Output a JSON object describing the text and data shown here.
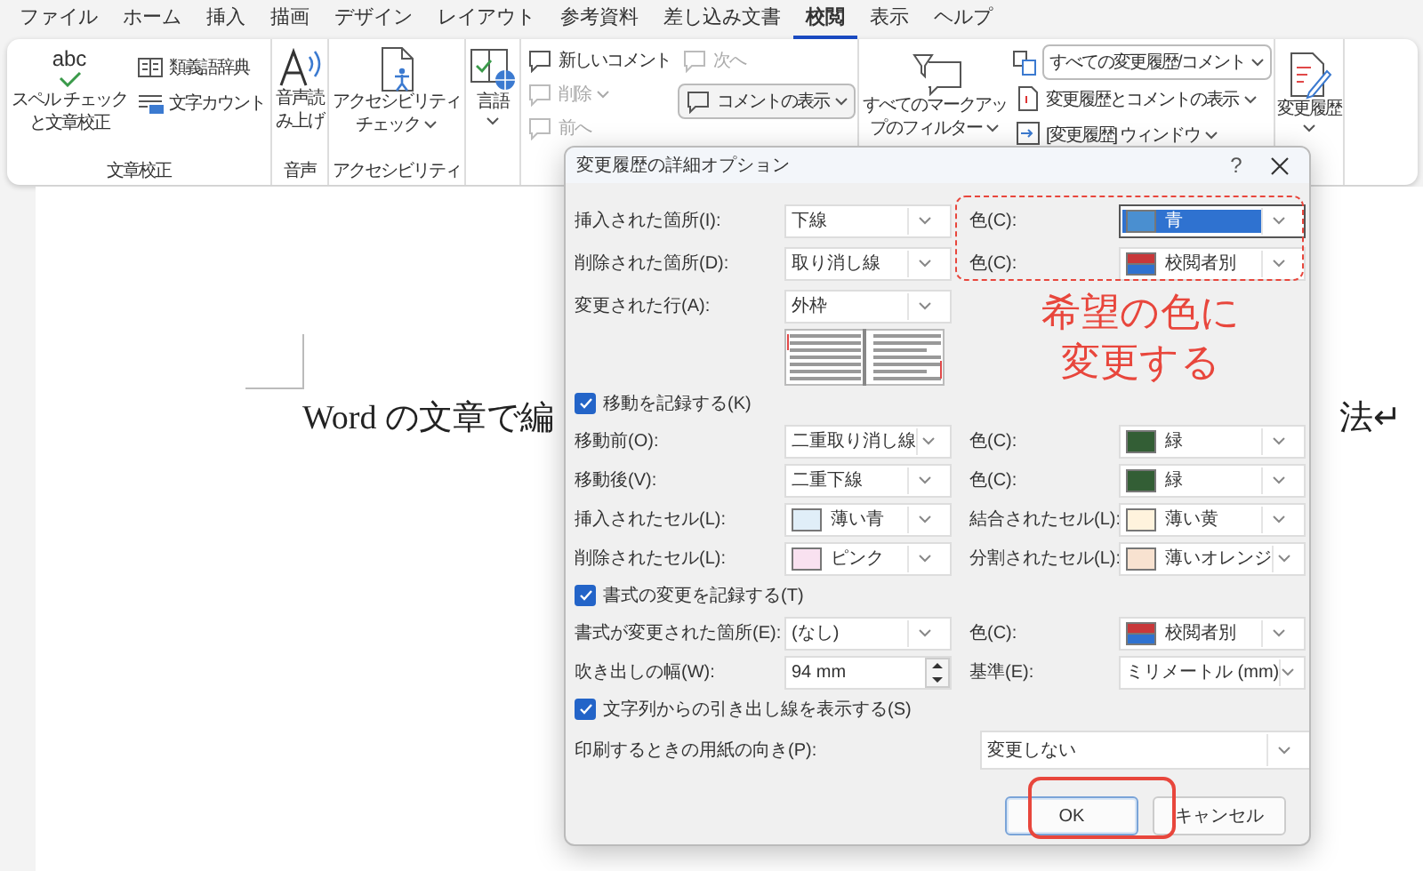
{
  "menu": [
    {
      "label": "ファイル",
      "selected": false
    },
    {
      "label": "ホーム",
      "selected": false
    },
    {
      "label": "挿入",
      "selected": false
    },
    {
      "label": "描画",
      "selected": false
    },
    {
      "label": "デザイン",
      "selected": false
    },
    {
      "label": "レイアウト",
      "selected": false
    },
    {
      "label": "参考資料",
      "selected": false
    },
    {
      "label": "差し込み文書",
      "selected": false
    },
    {
      "label": "校閲",
      "selected": true
    },
    {
      "label": "表示",
      "selected": false
    },
    {
      "label": "ヘルプ",
      "selected": false
    }
  ],
  "ribbon": {
    "proofing": {
      "label": "文章校正",
      "icon_text": "abc",
      "spelling": "スペル チェックと文章校正",
      "thesaurus": "類義語辞典",
      "word_count": "文字カウント"
    },
    "speech": {
      "label": "音声",
      "read_aloud": "音声読み上げ"
    },
    "accessibility": {
      "label": "アクセシビリティ",
      "check": "アクセシビリティチェック"
    },
    "language": {
      "button": "言語"
    },
    "comments": {
      "items": [
        {
          "label": "新しいコメント",
          "disabled": false
        },
        {
          "label": "削除",
          "disabled": true
        },
        {
          "label": "前へ",
          "disabled": true
        }
      ],
      "next": {
        "label": "次へ",
        "disabled": true
      },
      "show": "コメントの表示"
    },
    "tracking": {
      "filter": "すべてのマークアップのフィルター",
      "display": "すべての変更履歴/コメント",
      "show_markup": "変更履歴とコメントの表示",
      "pane": "[変更履歴] ウィンドウ"
    },
    "track_changes": "変更履歴"
  },
  "document": {
    "text_left": "Word の文章で編",
    "text_right": "法↵"
  },
  "dialog": {
    "title": "変更履歴の詳細オプション",
    "help": "?",
    "rows": [
      {
        "kind": "fields",
        "label": "挿入された箇所(I):",
        "value": "下線",
        "right": {
          "label": "色(C):",
          "value": "青",
          "color": "#4a8fd0",
          "focused": true
        }
      },
      {
        "kind": "fields",
        "label": "削除された箇所(D):",
        "value": "取り消し線",
        "right": {
          "label": "色(C):",
          "value": "校閲者別",
          "kind": "split",
          "focused": false
        }
      },
      {
        "kind": "fields",
        "label": "変更された行(A):",
        "value": "外枠"
      },
      {
        "kind": "preview"
      },
      {
        "kind": "checkbox",
        "label": "移動を記録する(K)",
        "checked": true
      },
      {
        "kind": "fields",
        "label": "移動前(O):",
        "value": "二重取り消し線",
        "right": {
          "label": "色(C):",
          "value": "緑",
          "color": "#335e35",
          "focused": false
        }
      },
      {
        "kind": "fields",
        "label": "移動後(V):",
        "value": "二重下線",
        "right": {
          "label": "色(C):",
          "value": "緑",
          "color": "#335e35",
          "focused": false
        }
      },
      {
        "kind": "fields",
        "label": "挿入されたセル(L):",
        "value": "薄い青",
        "color": "#e0eef8",
        "right": {
          "label": "結合されたセル(L):",
          "value": "薄い黄",
          "color": "#fff3dd",
          "focused": false
        }
      },
      {
        "kind": "fields",
        "label": "削除されたセル(L):",
        "value": "ピンク",
        "color": "#f9e1f0",
        "right": {
          "label": "分割されたセル(L):",
          "value": "薄いオレンジ",
          "color": "#f8e2d0",
          "focused": false
        }
      },
      {
        "kind": "checkbox",
        "label": "書式の変更を記録する(T)",
        "checked": true
      },
      {
        "kind": "fields",
        "label": "書式が変更された箇所(E):",
        "value": "(なし)",
        "right": {
          "label": "色(C):",
          "value": "校閲者別",
          "kind": "split",
          "focused": false
        }
      },
      {
        "kind": "spin",
        "label": "吹き出しの幅(W):",
        "value": "94 mm",
        "right": {
          "label": "基準(E):",
          "value": "ミリメートル (mm)",
          "focused": false
        }
      },
      {
        "kind": "checkbox",
        "label": "文字列からの引き出し線を表示する(S)",
        "checked": true
      },
      {
        "kind": "wide",
        "label": "印刷するときの用紙の向き(P):",
        "value": "変更しない"
      }
    ],
    "buttons": [
      {
        "label": "OK",
        "default": true
      },
      {
        "label": "キャンセル",
        "default": false
      }
    ]
  },
  "annotation": {
    "callout": "希望の色に変更する"
  }
}
